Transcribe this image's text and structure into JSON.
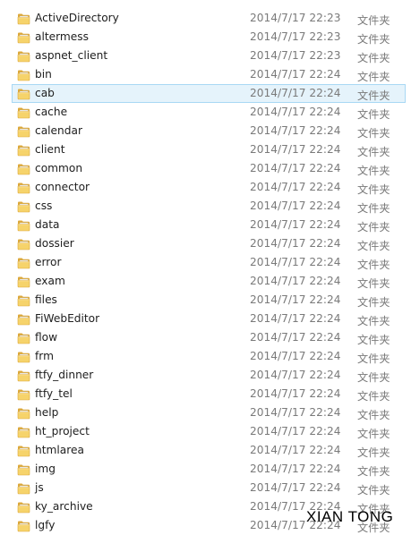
{
  "colors": {
    "folder_dark": "#dca83a",
    "folder_light": "#f6d36b",
    "selection_bg": "#e5f3fb",
    "selection_border": "#a8d8f4",
    "meta_text": "#7a7a7a"
  },
  "icon": "folder-icon",
  "files": [
    {
      "name": "ActiveDirectory",
      "date": "2014/7/17 22:23",
      "type": "文件夹"
    },
    {
      "name": "altermess",
      "date": "2014/7/17 22:23",
      "type": "文件夹"
    },
    {
      "name": "aspnet_client",
      "date": "2014/7/17 22:23",
      "type": "文件夹"
    },
    {
      "name": "bin",
      "date": "2014/7/17 22:24",
      "type": "文件夹"
    },
    {
      "name": "cab",
      "date": "2014/7/17 22:24",
      "type": "文件夹",
      "selected": true
    },
    {
      "name": "cache",
      "date": "2014/7/17 22:24",
      "type": "文件夹"
    },
    {
      "name": "calendar",
      "date": "2014/7/17 22:24",
      "type": "文件夹"
    },
    {
      "name": "client",
      "date": "2014/7/17 22:24",
      "type": "文件夹"
    },
    {
      "name": "common",
      "date": "2014/7/17 22:24",
      "type": "文件夹"
    },
    {
      "name": "connector",
      "date": "2014/7/17 22:24",
      "type": "文件夹"
    },
    {
      "name": "css",
      "date": "2014/7/17 22:24",
      "type": "文件夹"
    },
    {
      "name": "data",
      "date": "2014/7/17 22:24",
      "type": "文件夹"
    },
    {
      "name": "dossier",
      "date": "2014/7/17 22:24",
      "type": "文件夹"
    },
    {
      "name": "error",
      "date": "2014/7/17 22:24",
      "type": "文件夹"
    },
    {
      "name": "exam",
      "date": "2014/7/17 22:24",
      "type": "文件夹"
    },
    {
      "name": "files",
      "date": "2014/7/17 22:24",
      "type": "文件夹"
    },
    {
      "name": "FiWebEditor",
      "date": "2014/7/17 22:24",
      "type": "文件夹"
    },
    {
      "name": "flow",
      "date": "2014/7/17 22:24",
      "type": "文件夹"
    },
    {
      "name": "frm",
      "date": "2014/7/17 22:24",
      "type": "文件夹"
    },
    {
      "name": "ftfy_dinner",
      "date": "2014/7/17 22:24",
      "type": "文件夹"
    },
    {
      "name": "ftfy_tel",
      "date": "2014/7/17 22:24",
      "type": "文件夹"
    },
    {
      "name": "help",
      "date": "2014/7/17 22:24",
      "type": "文件夹"
    },
    {
      "name": "ht_project",
      "date": "2014/7/17 22:24",
      "type": "文件夹"
    },
    {
      "name": "htmlarea",
      "date": "2014/7/17 22:24",
      "type": "文件夹"
    },
    {
      "name": "img",
      "date": "2014/7/17 22:24",
      "type": "文件夹"
    },
    {
      "name": "js",
      "date": "2014/7/17 22:24",
      "type": "文件夹"
    },
    {
      "name": "ky_archive",
      "date": "2014/7/17 22:24",
      "type": "文件夹"
    },
    {
      "name": "lgfy",
      "date": "2014/7/17 22:24",
      "type": "文件夹"
    }
  ],
  "watermark": "XIAN TONG"
}
